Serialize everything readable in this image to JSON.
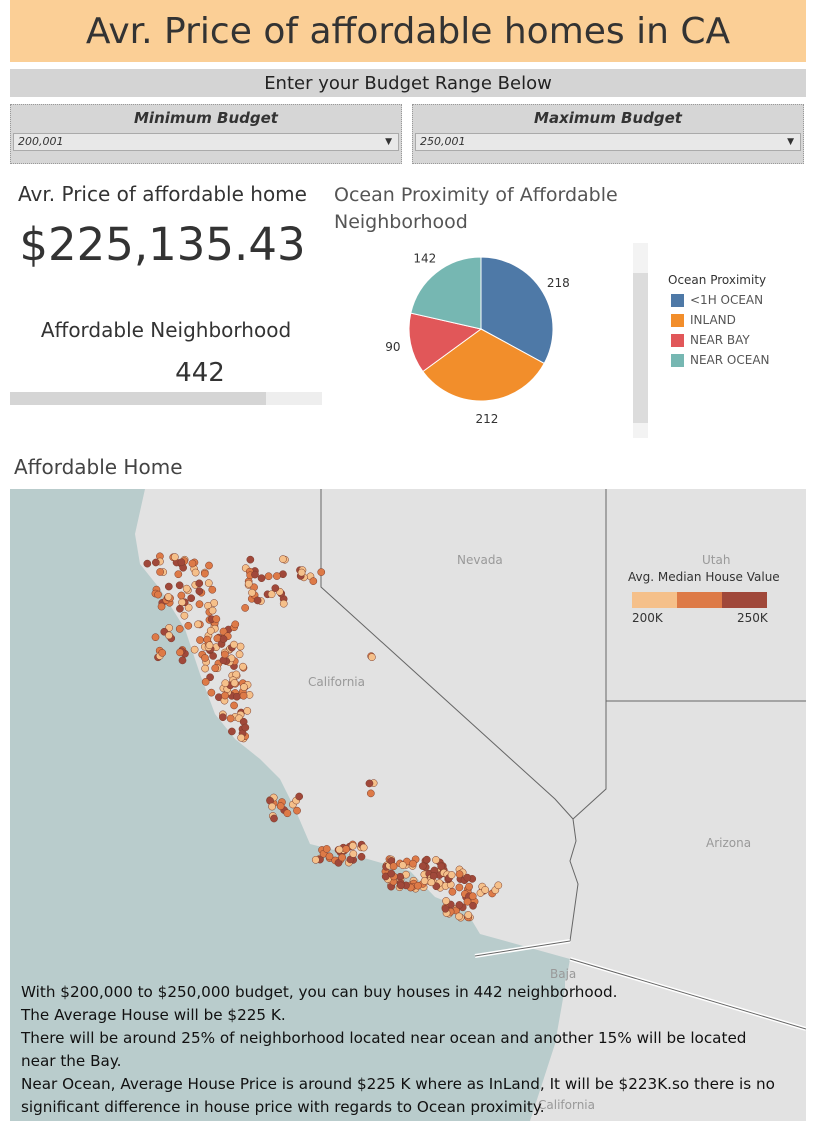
{
  "header": {
    "title": "Avr. Price of affordable homes in CA"
  },
  "budget": {
    "prompt": "Enter your Budget Range Below",
    "min_label": "Minimum Budget",
    "min_value": "200,001",
    "max_label": "Maximum Budget",
    "max_value": "250,001"
  },
  "kpi": {
    "avg_price_title": "Avr. Price of affordable home",
    "avg_price_value": "$225,135.43",
    "neighborhood_title": "Affordable Neighborhood",
    "neighborhood_value": "442",
    "neighborhood_bar_fraction": 0.82
  },
  "pie": {
    "title": "Ocean Proximity of Affordable Neighborhood",
    "legend_title": "Ocean Proximity",
    "slices": [
      {
        "label": "<1H OCEAN",
        "value": 218,
        "color": "#4e79a7"
      },
      {
        "label": "INLAND",
        "value": 212,
        "color": "#f28e2b"
      },
      {
        "label": "NEAR BAY",
        "value": 90,
        "color": "#e15759"
      },
      {
        "label": "NEAR OCEAN",
        "value": 142,
        "color": "#76b7b2"
      }
    ]
  },
  "map": {
    "title": "Affordable Home",
    "place_labels": {
      "nevada": "Nevada",
      "utah": "Utah",
      "california": "California",
      "arizona": "Arizona",
      "baja": "Baja",
      "baja_california": "California"
    },
    "legend": {
      "title": "Avg. Median House Value",
      "min_label": "200K",
      "max_label": "250K",
      "colors": [
        "#f5c08a",
        "#dd7a47",
        "#a0483a"
      ]
    },
    "water_color": "#b9cccc",
    "land_color": "#e2e2e2"
  },
  "insight": {
    "lines": [
      "With $200,000 to $250,000 budget, you can buy houses in 442 neighborhood.",
      "The Average House will be $225 K.",
      "There will be around 25% of neighborhood located near ocean and another 15% will be located near the Bay.",
      "Near Ocean, Average House Price is around $225 K where as InLand, It will be $223K.so there is no significant difference in house price with regards to Ocean proximity."
    ]
  }
}
